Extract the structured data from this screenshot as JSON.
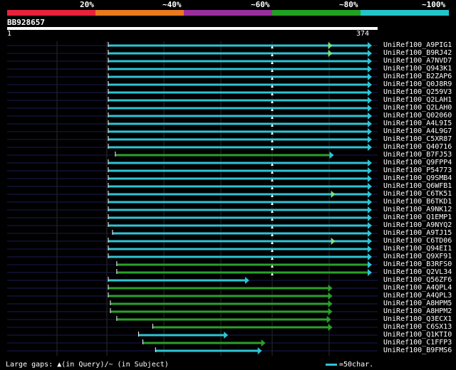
{
  "header": {
    "scale_labels": [
      "20%",
      "~40%",
      "~60%",
      "~80%",
      "~100%"
    ],
    "color_bands": [
      "#e8223a",
      "#e8791e",
      "#9a2e9e",
      "#22a020",
      "#22c4c8"
    ],
    "query_id": "BB928657",
    "query_start": "1",
    "query_end": "374"
  },
  "colors": {
    "cyan": "#2ec4d6",
    "green": "#2aa02a",
    "background": "#000000",
    "gridline": "#2a2a2a"
  },
  "hits": [
    {
      "name": "UniRef100_A9PIG1",
      "start": 1,
      "end": 374,
      "color": "cyan",
      "head_at": 316
    },
    {
      "name": "UniRef100_B9RJ42",
      "start": 1,
      "end": 374,
      "color": "cyan",
      "head_at": 316
    },
    {
      "name": "UniRef100_A7NVD7",
      "start": 1,
      "end": 374,
      "color": "cyan"
    },
    {
      "name": "UniRef100_Q943K1",
      "start": 1,
      "end": 374,
      "color": "cyan"
    },
    {
      "name": "UniRef100_B2ZAP6",
      "start": 1,
      "end": 374,
      "color": "cyan"
    },
    {
      "name": "UniRef100_Q0J8R9",
      "start": 1,
      "end": 374,
      "color": "cyan"
    },
    {
      "name": "UniRef100_Q259V3",
      "start": 1,
      "end": 374,
      "color": "cyan"
    },
    {
      "name": "UniRef100_Q2LAH1",
      "start": 1,
      "end": 374,
      "color": "cyan"
    },
    {
      "name": "UniRef100_Q2LAH0",
      "start": 1,
      "end": 374,
      "color": "cyan"
    },
    {
      "name": "UniRef100_Q02060",
      "start": 1,
      "end": 374,
      "color": "cyan"
    },
    {
      "name": "UniRef100_A4L9I5",
      "start": 1,
      "end": 374,
      "color": "cyan"
    },
    {
      "name": "UniRef100_A4L9G7",
      "start": 1,
      "end": 374,
      "color": "cyan"
    },
    {
      "name": "UniRef100_C5XR87",
      "start": 1,
      "end": 374,
      "color": "cyan"
    },
    {
      "name": "UniRef100_Q40716",
      "start": 1,
      "end": 374,
      "color": "cyan"
    },
    {
      "name": "UniRef100_B7FJ53",
      "start": 11,
      "end": 320,
      "color": "green",
      "tail_cyan": true
    },
    {
      "name": "UniRef100_Q9FPP4",
      "start": 1,
      "end": 374,
      "color": "cyan"
    },
    {
      "name": "UniRef100_P54773",
      "start": 1,
      "end": 374,
      "color": "cyan"
    },
    {
      "name": "UniRef100_Q9SMB4",
      "start": 1,
      "end": 374,
      "color": "cyan"
    },
    {
      "name": "UniRef100_Q6WFB1",
      "start": 1,
      "end": 374,
      "color": "cyan"
    },
    {
      "name": "UniRef100_C6TK51",
      "start": 1,
      "end": 374,
      "color": "cyan",
      "head_at": 320
    },
    {
      "name": "UniRef100_B6TKD1",
      "start": 1,
      "end": 374,
      "color": "cyan"
    },
    {
      "name": "UniRef100_A9NK12",
      "start": 1,
      "end": 374,
      "color": "cyan"
    },
    {
      "name": "UniRef100_Q1EMP1",
      "start": 1,
      "end": 374,
      "color": "cyan"
    },
    {
      "name": "UniRef100_A9NYQ2",
      "start": 1,
      "end": 374,
      "color": "cyan"
    },
    {
      "name": "UniRef100_A9TJ15",
      "start": 7,
      "end": 374,
      "color": "cyan"
    },
    {
      "name": "UniRef100_C6TD06",
      "start": 1,
      "end": 374,
      "color": "cyan",
      "head_at": 320
    },
    {
      "name": "UniRef100_Q94EI1",
      "start": 1,
      "end": 374,
      "color": "cyan"
    },
    {
      "name": "UniRef100_Q9XF91",
      "start": 1,
      "end": 374,
      "color": "cyan"
    },
    {
      "name": "UniRef100_B3RFS0",
      "start": 13,
      "end": 374,
      "color": "green",
      "tail_cyan": true
    },
    {
      "name": "UniRef100_Q2VL34",
      "start": 13,
      "end": 374,
      "color": "green",
      "tail_cyan": true
    },
    {
      "name": "UniRef100_Q56ZF6",
      "start": 1,
      "end": 200,
      "color": "cyan"
    },
    {
      "name": "UniRef100_A4QPL4",
      "start": 1,
      "end": 318,
      "color": "green"
    },
    {
      "name": "UniRef100_A4QPL3",
      "start": 1,
      "end": 318,
      "color": "green"
    },
    {
      "name": "UniRef100_A8HPM5",
      "start": 4,
      "end": 318,
      "color": "green"
    },
    {
      "name": "UniRef100_A8HPM2",
      "start": 4,
      "end": 318,
      "color": "green"
    },
    {
      "name": "UniRef100_Q3ECX1",
      "start": 13,
      "end": 316,
      "color": "green"
    },
    {
      "name": "UniRef100_C6SX13",
      "start": 64,
      "end": 318,
      "color": "green"
    },
    {
      "name": "UniRef100_Q1KTI0",
      "start": 44,
      "end": 170,
      "color": "cyan"
    },
    {
      "name": "UniRef100_C1FFP3",
      "start": 50,
      "end": 223,
      "color": "green"
    },
    {
      "name": "UniRef100_B9FMS6",
      "start": 68,
      "end": 218,
      "color": "cyan"
    }
  ],
  "legend": {
    "text": "Large gaps: ▲(in Query)/~ (in Subject)",
    "scale": "=50char."
  }
}
